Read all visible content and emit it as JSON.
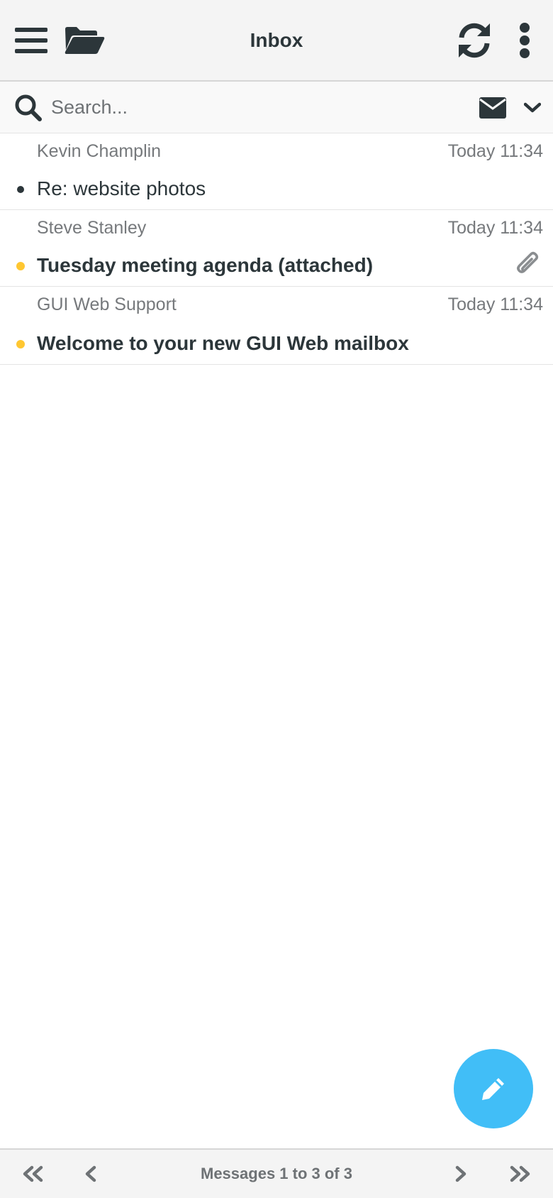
{
  "header": {
    "title": "Inbox",
    "icons": [
      "menu-icon",
      "folder-open-icon",
      "refresh-icon",
      "more-vertical-icon"
    ]
  },
  "search": {
    "placeholder": "Search...",
    "value": "",
    "icons": [
      "search-icon",
      "envelope-icon",
      "chevron-down-icon"
    ]
  },
  "messages": [
    {
      "from": "Kevin Champlin",
      "date": "Today 11:34",
      "subject": "Re: website photos",
      "unread": false,
      "status_color": "#2c363a",
      "has_attachment": false
    },
    {
      "from": "Steve Stanley",
      "date": "Today 11:34",
      "subject": "Tuesday meeting agenda (attached)",
      "unread": true,
      "status_color": "#ffc731",
      "has_attachment": true
    },
    {
      "from": "GUI Web Support",
      "date": "Today 11:34",
      "subject": "Welcome to your new GUI Web mailbox",
      "unread": true,
      "status_color": "#ffc731",
      "has_attachment": false
    }
  ],
  "compose": {
    "icon": "pencil-icon",
    "color": "#41bef7"
  },
  "footer": {
    "pagination_text": "Messages 1 to 3 of 3",
    "icons": [
      "first-page-icon",
      "previous-page-icon",
      "next-page-icon",
      "last-page-icon"
    ]
  },
  "colors": {
    "text_primary": "#2c363a",
    "text_secondary": "#76797c",
    "unread_dot": "#ffc731",
    "accent": "#41bef7"
  }
}
